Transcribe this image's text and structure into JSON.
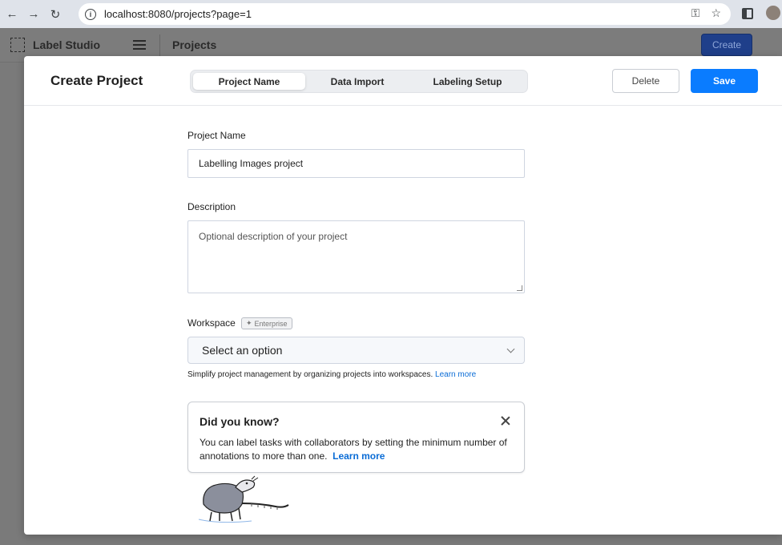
{
  "browser": {
    "url": "localhost:8080/projects?page=1",
    "back_glyph": "←",
    "forward_glyph": "→",
    "reload_glyph": "↻",
    "info_glyph": "i",
    "key_glyph": "⚿",
    "star_glyph": "☆"
  },
  "app": {
    "name": "Label Studio",
    "page_title": "Projects",
    "create_label": "Create"
  },
  "modal": {
    "title": "Create Project",
    "tabs": [
      {
        "label": "Project Name",
        "active": true
      },
      {
        "label": "Data Import",
        "active": false
      },
      {
        "label": "Labeling Setup",
        "active": false
      }
    ],
    "delete_label": "Delete",
    "save_label": "Save",
    "form": {
      "project_name_label": "Project Name",
      "project_name_value": "Labelling Images project",
      "description_label": "Description",
      "description_placeholder": "Optional description of your project",
      "workspace_label": "Workspace",
      "enterprise_badge": "Enterprise",
      "workspace_select_value": "Select an option",
      "helper_text": "Simplify project management by organizing projects into workspaces.",
      "helper_link": "Learn more"
    },
    "tip": {
      "title": "Did you know?",
      "body": "You can label tasks with collaborators by setting the minimum number of annotations to more than one.",
      "link": "Learn more"
    }
  },
  "colors": {
    "primary": "#0a7cff",
    "link": "#0a6cd6",
    "overlay": "#7a7a7a"
  }
}
